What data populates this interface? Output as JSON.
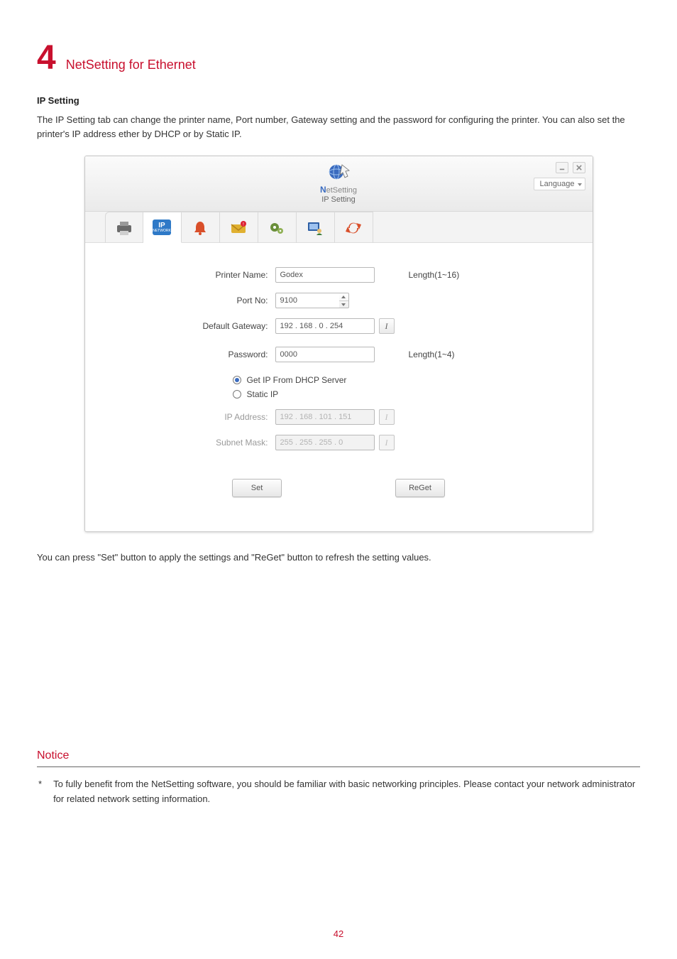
{
  "chapter": {
    "number": "4",
    "title": "NetSetting for Ethernet"
  },
  "section": {
    "heading": "IP Setting",
    "intro": "The IP Setting tab can change the printer name, Port number, Gateway setting and the password for configuring the printer. You can also set the printer's IP address ether by DHCP or by Static IP.",
    "after": "You can press \"Set\" button to apply the settings and \"ReGet\" button to refresh the setting values."
  },
  "window": {
    "brand_name": "NetSetting",
    "brand_sub": "IP Setting",
    "language_label": "Language",
    "tabs_ip_label": "IP",
    "tabs_ip_sub": "NETWORK"
  },
  "form": {
    "printer_name_label": "Printer Name:",
    "printer_name_value": "Godex",
    "printer_name_hint": "Length(1~16)",
    "port_label": "Port No:",
    "port_value": "9100",
    "gateway_label": "Default Gateway:",
    "gateway_value": "192 . 168 . 0 . 254",
    "password_label": "Password:",
    "password_value": "0000",
    "password_hint": "Length(1~4)",
    "dhcp_label": "Get IP From DHCP Server",
    "static_label": "Static IP",
    "ipaddr_label": "IP Address:",
    "ipaddr_value": "192 . 168 . 101 . 151",
    "subnet_label": "Subnet Mask:",
    "subnet_value": "255 . 255 . 255 . 0",
    "set_btn": "Set",
    "reget_btn": "ReGet",
    "ibtn": "I"
  },
  "notice": {
    "heading": "Notice",
    "bullet": "*",
    "text": "To fully benefit from the NetSetting software, you should be familiar with basic networking principles. Please contact your network administrator for related network setting information."
  },
  "page_number": "42"
}
